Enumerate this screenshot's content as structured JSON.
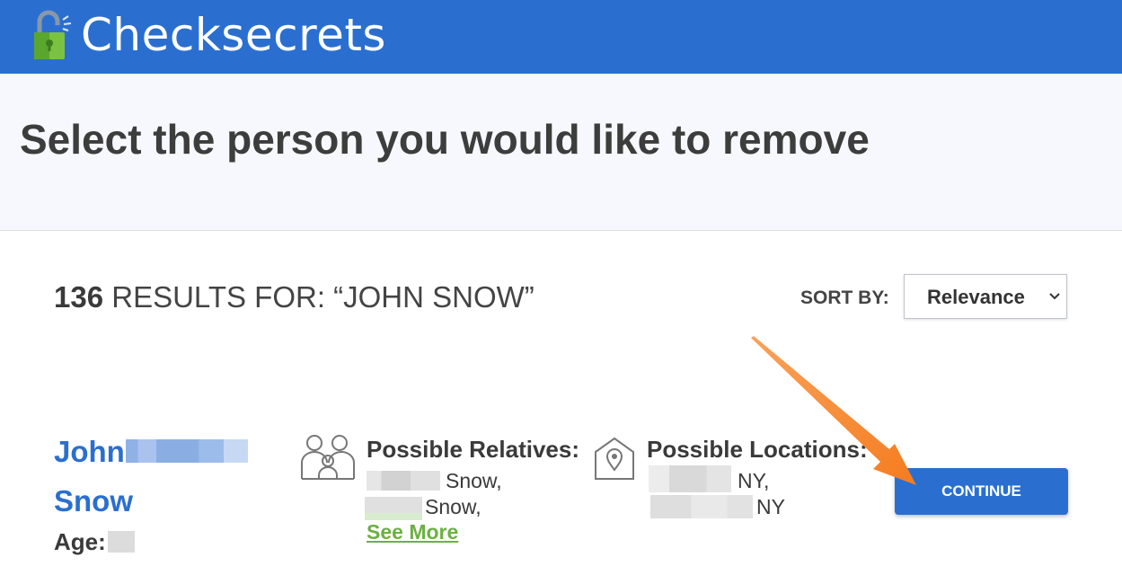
{
  "header": {
    "brand_name": "Checksecrets",
    "logo_icon": "padlock-icon",
    "background_color": "#2a6fd0"
  },
  "page": {
    "title": "Select the person you would like to remove"
  },
  "results": {
    "count": "136",
    "label": "RESULTS FOR: “JOHN SNOW”",
    "sort_label": "SORT BY:",
    "sort_value": "Relevance"
  },
  "person": {
    "first_name": "John",
    "last_name": "Snow",
    "age_label": "Age:",
    "relatives_heading": "Possible Relatives:",
    "relatives": [
      "Snow,",
      "Snow,"
    ],
    "see_more": "See More",
    "locations_heading": "Possible Locations:",
    "locations": [
      "NY,",
      "NY"
    ],
    "continue_label": "CONTINUE"
  },
  "colors": {
    "accent_blue": "#2a6fd0",
    "link_green": "#6cb043",
    "arrow_orange": "#f57c1f"
  }
}
